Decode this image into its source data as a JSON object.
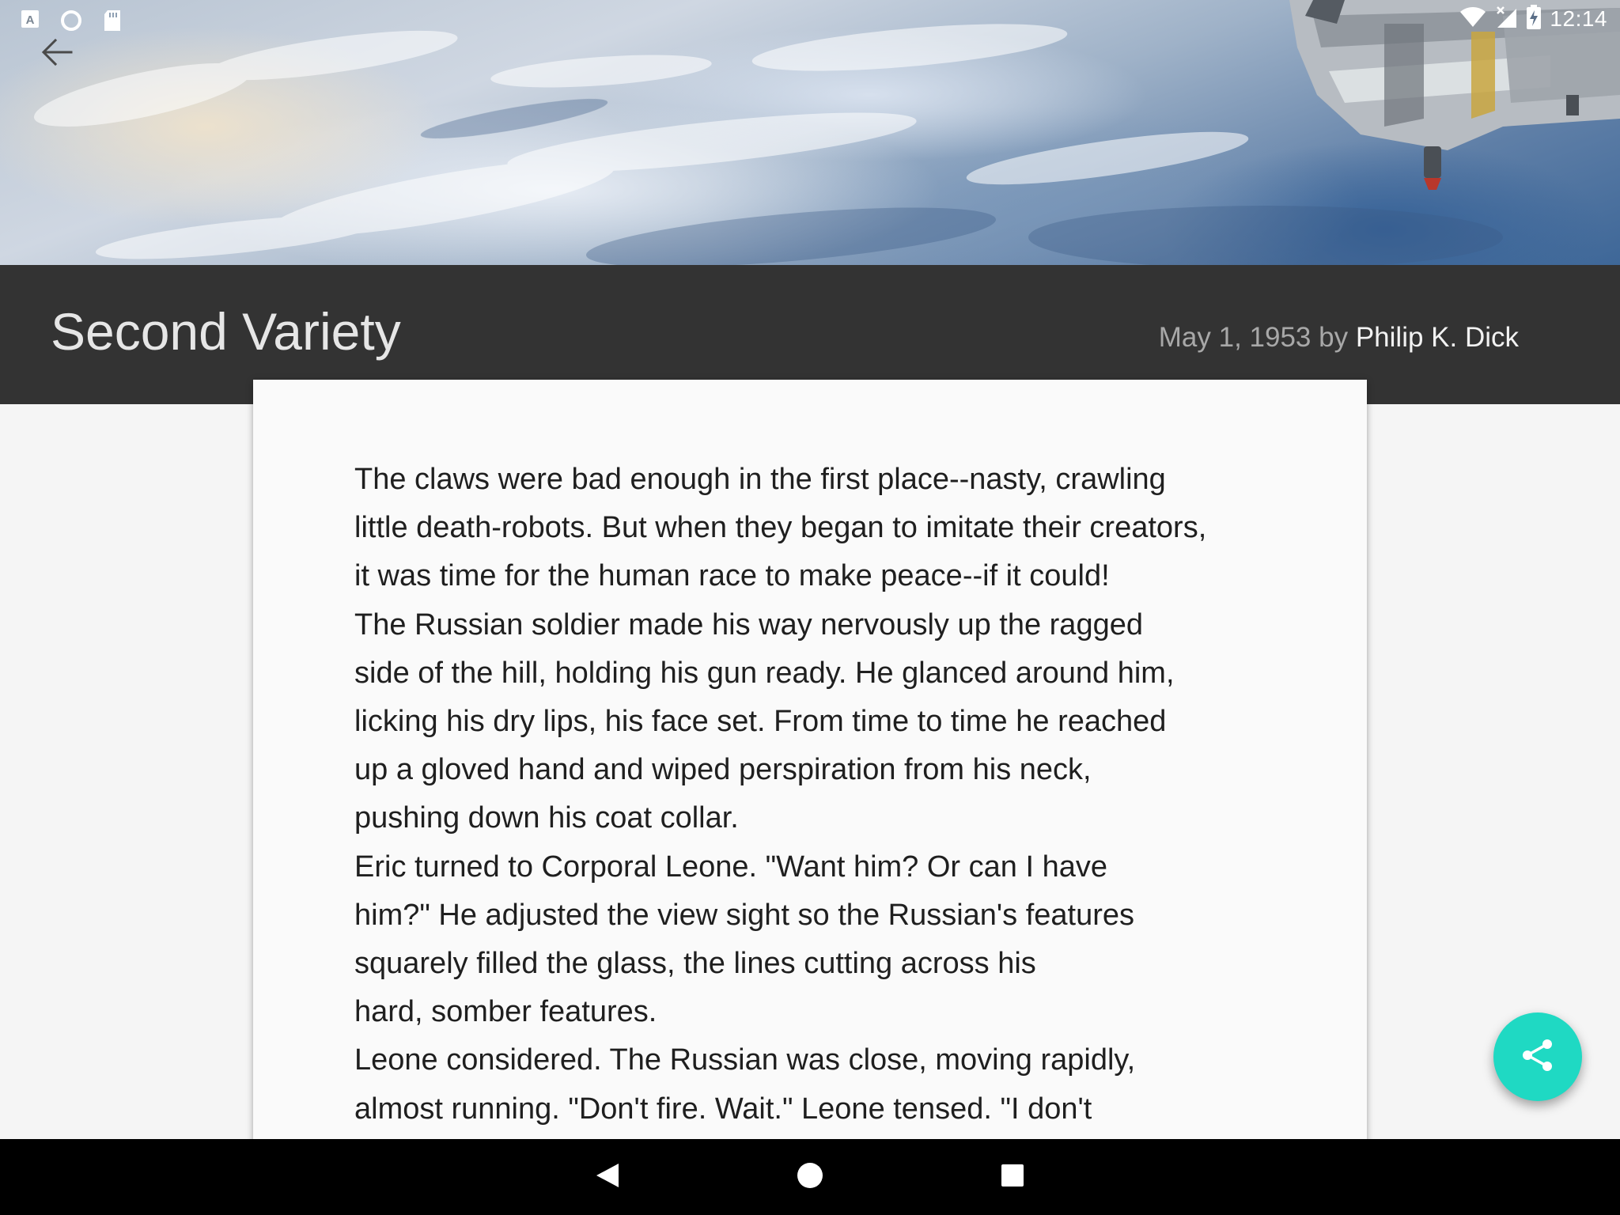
{
  "status_bar": {
    "left_icons": [
      "autofill-a-icon",
      "circle-sync-icon",
      "sd-card-icon"
    ],
    "right_icons": [
      "wifi-icon",
      "no-signal-icon",
      "battery-charging-icon"
    ],
    "time": "12:14"
  },
  "header": {
    "back_icon": "arrow-back-icon",
    "image": "earth-from-orbit-with-space-station"
  },
  "story": {
    "title": "Second Variety",
    "date": "May 1, 1953",
    "by": "by",
    "author": "Philip K. Dick"
  },
  "article": {
    "lines": [
      "The claws were bad enough in the first place--nasty, crawling",
      "little death-robots. But when they began to imitate their creators,",
      "it was time for the human race to make peace--if it could!",
      "The Russian soldier made his way nervously up the ragged",
      "side of the hill, holding his gun ready. He glanced around him,",
      "licking his dry lips, his face set. From time to time he reached",
      "up a gloved hand and wiped perspiration from his neck,",
      "pushing down his coat collar.",
      "Eric turned to Corporal Leone. \"Want him? Or can I have",
      "him?\" He adjusted the view sight so the Russian's features",
      "squarely filled the glass, the lines cutting across his",
      "hard, somber features.",
      "Leone considered. The Russian was close, moving rapidly,",
      "almost running. \"Don't fire. Wait.\" Leone tensed. \"I don't"
    ]
  },
  "fab": {
    "icon": "share-icon",
    "color": "#1fd9c3"
  },
  "nav_bar": {
    "buttons": [
      "back-triangle-icon",
      "home-circle-icon",
      "recents-square-icon"
    ]
  },
  "colors": {
    "title_band": "#333333",
    "card": "#fafafa",
    "page": "#f5f5f5"
  }
}
